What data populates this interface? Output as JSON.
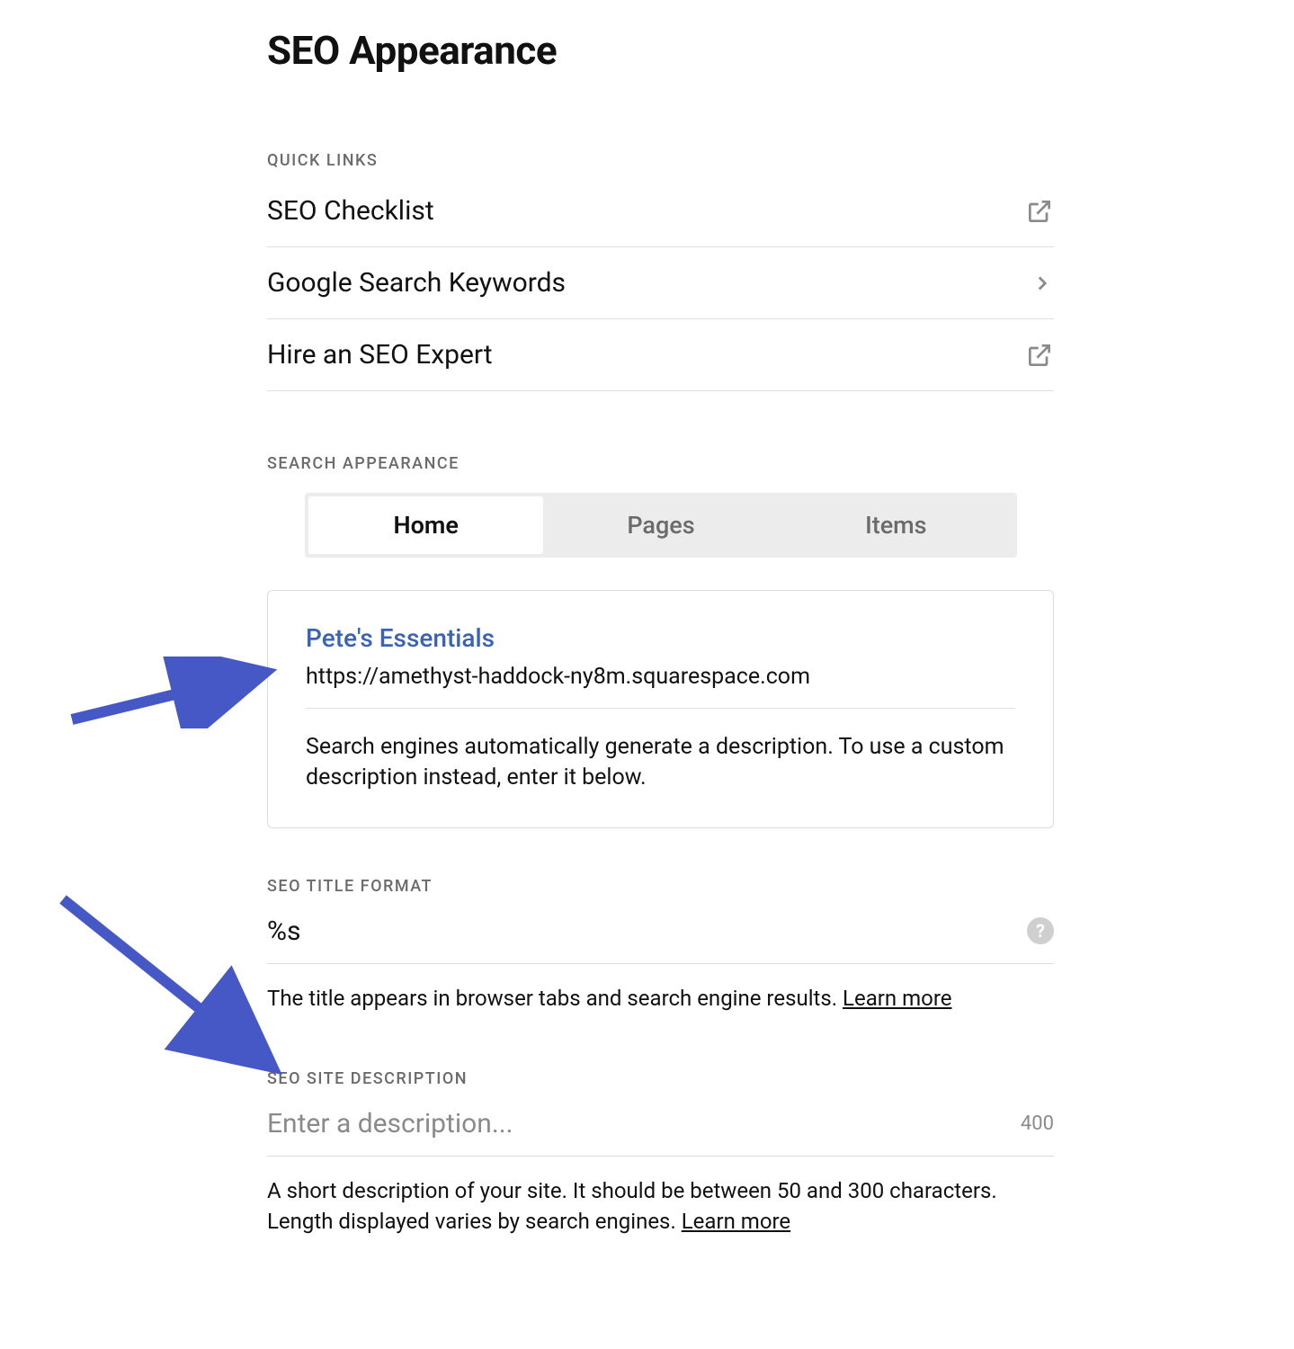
{
  "header": {
    "title": "SEO Appearance"
  },
  "quick_links": {
    "label": "QUICK LINKS",
    "items": [
      {
        "label": "SEO Checklist",
        "icon": "external"
      },
      {
        "label": "Google Search Keywords",
        "icon": "chevron"
      },
      {
        "label": "Hire an SEO Expert",
        "icon": "external"
      }
    ]
  },
  "search_appearance": {
    "label": "SEARCH APPEARANCE",
    "tabs": [
      {
        "label": "Home",
        "active": true
      },
      {
        "label": "Pages",
        "active": false
      },
      {
        "label": "Items",
        "active": false
      }
    ],
    "preview": {
      "title": "Pete's Essentials",
      "url": "https://amethyst-haddock-ny8m.squarespace.com",
      "description": "Search engines automatically generate a description. To use a custom description instead, enter it below."
    }
  },
  "seo_title_format": {
    "label": "SEO TITLE FORMAT",
    "value": "%s",
    "helper_text": "The title appears in browser tabs and search engine results. ",
    "learn_more": "Learn more"
  },
  "seo_site_description": {
    "label": "SEO SITE DESCRIPTION",
    "placeholder": "Enter a description...",
    "char_limit": "400",
    "helper_text": "A short description of your site. It should be between 50 and 300 characters. Length displayed varies by search engines. ",
    "learn_more": "Learn more"
  },
  "annotations": {
    "arrow1_target": "preview-url",
    "arrow2_target": "seo-site-description-section"
  }
}
